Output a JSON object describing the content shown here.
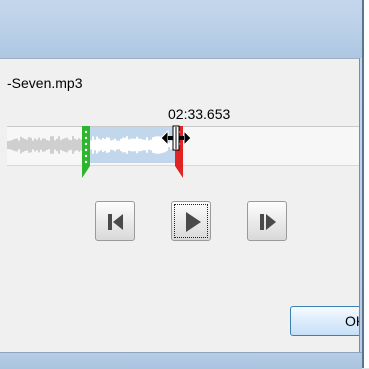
{
  "window": {
    "title": ""
  },
  "file": {
    "name": "-Seven.mp3"
  },
  "playhead": {
    "time": "02:33.653"
  },
  "track": {
    "selection_start_fraction": 0.225,
    "selection_end_fraction": 0.49,
    "start_marker_color": "#2db52d",
    "end_marker_color": "#e02424",
    "selection_color": "#c3d7ec"
  },
  "transport": {
    "buttons": [
      {
        "name": "previous-icon",
        "focused": false
      },
      {
        "name": "play-icon",
        "focused": true
      },
      {
        "name": "next-icon",
        "focused": false
      }
    ]
  },
  "dialog": {
    "ok_label": "OK"
  },
  "cursor": {
    "name": "resize-horizontal-cursor-icon"
  }
}
